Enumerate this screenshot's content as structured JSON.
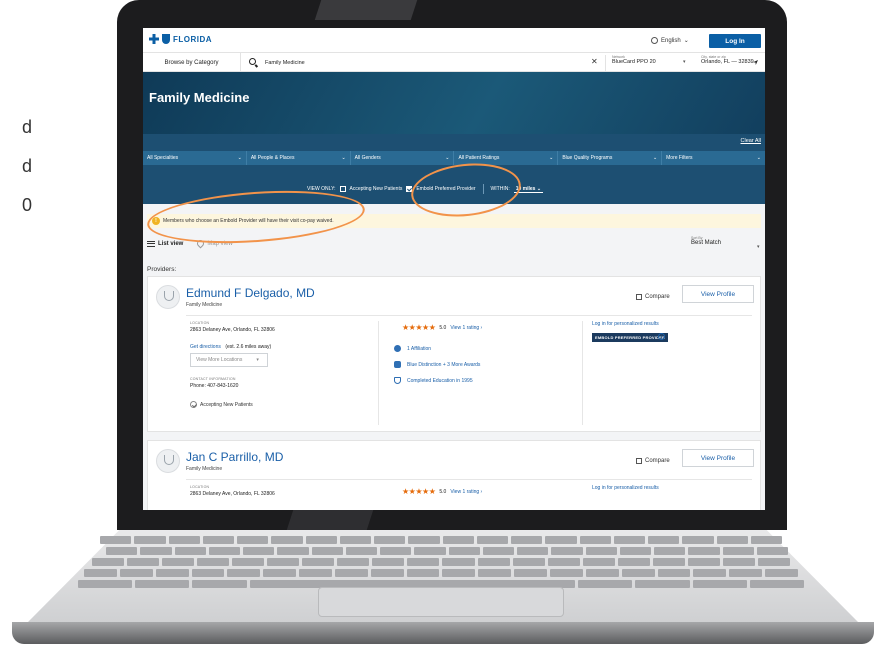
{
  "left_crop": [
    "d",
    "d",
    "0"
  ],
  "header": {
    "brand": "FLORIDA",
    "language": "English",
    "login_label": "Log In"
  },
  "searchbar": {
    "browse_label": "Browse by Category",
    "search_value": "Family Medicine",
    "network_label": "Network",
    "network_value": "BlueCard PPO 20",
    "city_label": "City, state or zip",
    "city_value": "Orlando, FL — 32839"
  },
  "hero": {
    "title": "Family Medicine",
    "clear_all": "Clear All"
  },
  "filters": [
    "All Specialties",
    "All People & Places",
    "All Genders",
    "All Patient Ratings",
    "Blue Quality Programs",
    "More Filters"
  ],
  "view_only": {
    "label": "VIEW ONLY:",
    "accepting_label": "Accepting New Patients",
    "accepting_checked": false,
    "embold_label": "Embold Preferred Provider",
    "embold_checked": true,
    "within_label": "WITHIN:",
    "within_value": "10 miles"
  },
  "banner": {
    "text": "Members who choose an Embold Provider will have their visit co-pay waived.",
    "icon": "warning-icon",
    "color": "#fdf6de"
  },
  "views": {
    "list_label": "List view",
    "map_label": "Map view",
    "sort_label": "Sort By",
    "sort_value": "Best Match"
  },
  "providers_title": "Providers:",
  "providers": [
    {
      "name": "Edmund F Delgado, MD",
      "specialty": "Family Medicine",
      "compare_label": "Compare",
      "view_profile": "View Profile",
      "location_label": "LOCATION",
      "address": "2863 Delaney Ave, Orlando, FL 32806",
      "directions": "Get directions",
      "distance": "(est. 2.6 miles away)",
      "view_more_locations": "View More Locations",
      "contact_label": "CONTACT INFORMATION",
      "phone": "Phone: 407-843-1620",
      "accepting": "Accepting New Patients",
      "stars": "★★★★★",
      "rating_score": "5.0",
      "rating_link": "View 1 rating",
      "affiliation": "1 Affiliation",
      "awards": "Blue Distinction + 3 More Awards",
      "education": "Completed Education in 1995",
      "login_results": "Log in for personalized results",
      "badge": "EMBOLD PREFERRED PROVIDER"
    },
    {
      "name": "Jan C Parrillo, MD",
      "specialty": "Family Medicine",
      "compare_label": "Compare",
      "view_profile": "View Profile",
      "location_label": "LOCATION",
      "address": "2863 Delaney Ave, Orlando, FL 32806",
      "stars": "★★★★★",
      "rating_score": "5.0",
      "rating_link": "View 1 rating",
      "login_results": "Log in for personalized results"
    }
  ],
  "colors": {
    "brand_blue": "#0b5fa5",
    "hero": "#1b5978",
    "star": "#e56b0b",
    "annotation": "#f2934a"
  }
}
